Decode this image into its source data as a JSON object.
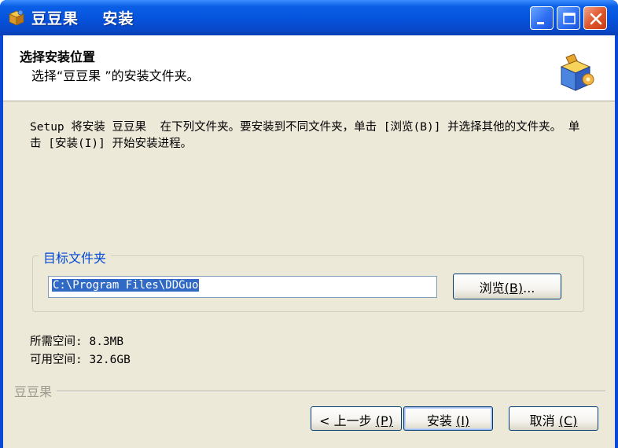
{
  "window": {
    "title": "豆豆果    安装",
    "colors": {
      "titlebar": "#0652dc",
      "face": "#ece9d8",
      "accent": "#0046d5",
      "close": "#e2582d"
    }
  },
  "header": {
    "title": "选择安装位置",
    "subtitle": "选择“豆豆果 ”的安装文件夹。",
    "icon": "installer-box-icon"
  },
  "intro_text": "Setup 将安装 豆豆果  在下列文件夹。要安装到不同文件夹，单击 [浏览(B)] 并选择其他的文件夹。 单击 [安装(I)] 开始安装进程。",
  "destination": {
    "legend": "目标文件夹",
    "path": "C:\\Program Files\\DDGuo",
    "browse_label": "浏览",
    "browse_mnemonic": "(B)",
    "browse_suffix": "..."
  },
  "space": {
    "required_label": "所需空间:",
    "required_value": "8.3MB",
    "available_label": "可用空间:",
    "available_value": "32.6GB"
  },
  "branding": "豆豆果",
  "buttons": {
    "back_label": "< 上一步",
    "back_mnemonic": "(P)",
    "install_label": "安装",
    "install_mnemonic": "(I)",
    "cancel_label": "取消",
    "cancel_mnemonic": "(C)"
  }
}
